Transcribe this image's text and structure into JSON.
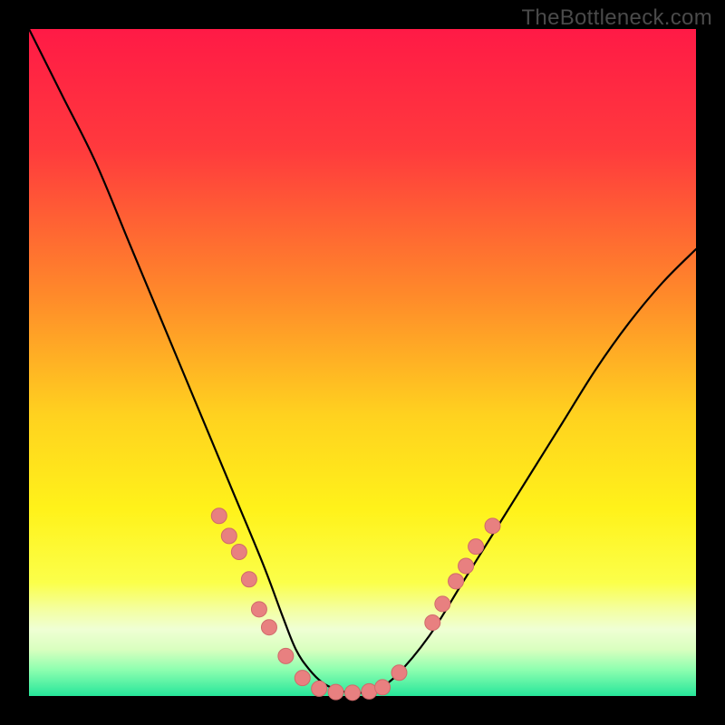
{
  "watermark": "TheBottleneck.com",
  "gradient": {
    "stops": [
      {
        "pct": 0,
        "color": "#ff1a46"
      },
      {
        "pct": 18,
        "color": "#ff3a3d"
      },
      {
        "pct": 40,
        "color": "#ff8a2a"
      },
      {
        "pct": 58,
        "color": "#ffd21f"
      },
      {
        "pct": 72,
        "color": "#fff21a"
      },
      {
        "pct": 83,
        "color": "#fbff4a"
      },
      {
        "pct": 87,
        "color": "#f4ffa0"
      },
      {
        "pct": 90,
        "color": "#efffd4"
      },
      {
        "pct": 93,
        "color": "#d9ffbf"
      },
      {
        "pct": 96,
        "color": "#8fffb0"
      },
      {
        "pct": 100,
        "color": "#26e69a"
      }
    ]
  },
  "chart_data": {
    "type": "line",
    "title": "",
    "xlabel": "",
    "ylabel": "",
    "xlim": [
      0,
      100
    ],
    "ylim": [
      0,
      100
    ],
    "grid": false,
    "legend": false,
    "series": [
      {
        "name": "bottleneck-curve",
        "x": [
          0,
          5,
          10,
          15,
          20,
          25,
          30,
          35,
          38,
          40,
          42,
          44,
          46,
          48,
          50,
          52,
          55,
          60,
          65,
          70,
          75,
          80,
          85,
          90,
          95,
          100
        ],
        "y": [
          100,
          90,
          80,
          68,
          56,
          44,
          32,
          20,
          12,
          7,
          4,
          2,
          1,
          0.5,
          0.5,
          1,
          3,
          9,
          17,
          25,
          33,
          41,
          49,
          56,
          62,
          67
        ]
      }
    ],
    "markers": [
      {
        "name": "left-cluster",
        "x": 28.5,
        "y": 27.0
      },
      {
        "name": "left-cluster",
        "x": 30.0,
        "y": 24.0
      },
      {
        "name": "left-cluster",
        "x": 31.5,
        "y": 21.6
      },
      {
        "name": "left-cluster",
        "x": 33.0,
        "y": 17.5
      },
      {
        "name": "left-cluster",
        "x": 34.5,
        "y": 13.0
      },
      {
        "name": "left-cluster",
        "x": 36.0,
        "y": 10.3
      },
      {
        "name": "left-cluster",
        "x": 38.5,
        "y": 6.0
      },
      {
        "name": "left-cluster",
        "x": 41.0,
        "y": 2.7
      },
      {
        "name": "bottom-flat",
        "x": 43.5,
        "y": 1.1
      },
      {
        "name": "bottom-flat",
        "x": 46.0,
        "y": 0.6
      },
      {
        "name": "bottom-flat",
        "x": 48.5,
        "y": 0.5
      },
      {
        "name": "bottom-flat",
        "x": 51.0,
        "y": 0.7
      },
      {
        "name": "bottom-flat",
        "x": 53.0,
        "y": 1.3
      },
      {
        "name": "right-cluster",
        "x": 55.5,
        "y": 3.5
      },
      {
        "name": "right-cluster",
        "x": 60.5,
        "y": 11.0
      },
      {
        "name": "right-cluster",
        "x": 62.0,
        "y": 13.8
      },
      {
        "name": "right-cluster",
        "x": 64.0,
        "y": 17.2
      },
      {
        "name": "right-cluster",
        "x": 65.5,
        "y": 19.5
      },
      {
        "name": "right-cluster",
        "x": 67.0,
        "y": 22.4
      },
      {
        "name": "right-cluster",
        "x": 69.5,
        "y": 25.5
      }
    ],
    "marker_style": {
      "fill": "#e88080",
      "stroke": "#d06a6a",
      "r": 8.5
    },
    "curve_style": {
      "stroke": "#000000",
      "width": 2.2
    }
  }
}
